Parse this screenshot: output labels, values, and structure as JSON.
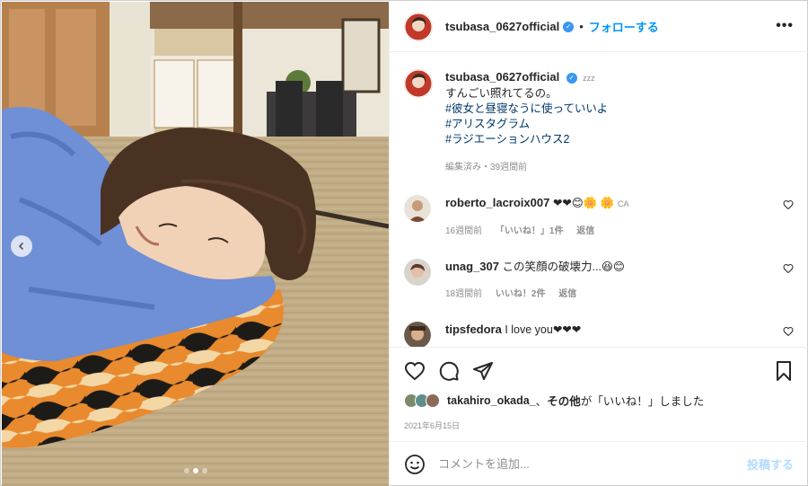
{
  "post": {
    "username": "tsubasa_0627official",
    "verified_mark": "✓",
    "header_separator": "•",
    "follow_label": "フォローする",
    "more_label": "•••",
    "sleep_mark": "zzz"
  },
  "caption": {
    "username": "tsubasa_0627official",
    "text": "すんごい照れてるの。",
    "hashtags": [
      "#彼女と昼寝なうに使っていいよ",
      "#アリスタグラム",
      "#ラジエーションハウス2"
    ],
    "meta": "編集済み・39週間前"
  },
  "comments": [
    {
      "username": "roberto_lacroix007",
      "text": "❤❤😊🌼 🌼",
      "suffix": "CA",
      "time": "16週間前",
      "likes": "「いいね！」1件",
      "reply": "返信"
    },
    {
      "username": "unag_307",
      "text": "この笑顔の破壊力...😆😊",
      "time": "18週間前",
      "likes": "いいね！2件",
      "reply": "返信"
    },
    {
      "username": "tipsfedora",
      "text": "I love you❤❤❤"
    }
  ],
  "likes_line": {
    "first_user": "takahiro_okada_",
    "separator": "、",
    "others": "その他",
    "suffix": "が「いいね！」しました"
  },
  "date": "2021年6月15日",
  "add_comment": {
    "placeholder": "コメントを追加...",
    "post_label": "投稿する"
  },
  "carousel": {
    "current_index": 1,
    "total": 3
  },
  "colors": {
    "link_blue": "#0095f6",
    "hashtag_blue": "#00376b",
    "verified_blue": "#3897f0",
    "muted_gray": "#8e8e8e",
    "post_disabled": "#b3dbff"
  },
  "icons": [
    "chevron-left-icon",
    "verified-badge-icon",
    "more-icon",
    "heart-icon",
    "comment-icon",
    "share-icon",
    "bookmark-icon",
    "emoji-icon"
  ]
}
